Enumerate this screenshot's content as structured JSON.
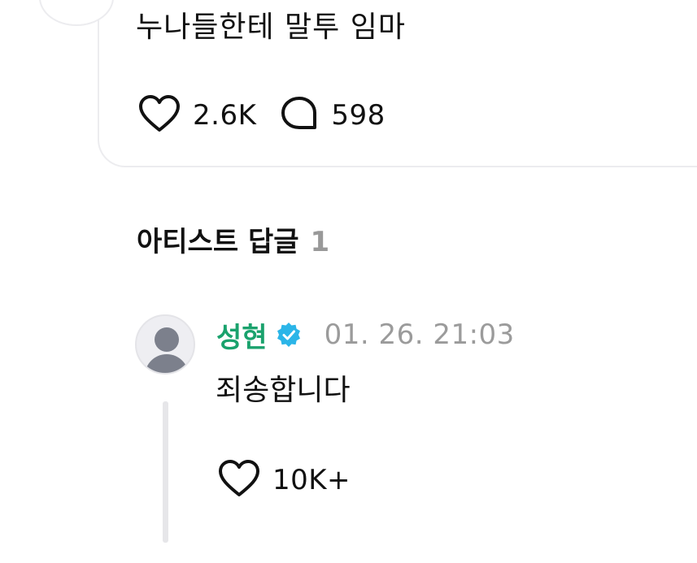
{
  "post": {
    "text": "누나들한테 말투 임마",
    "likes": "2.6K",
    "comments": "598"
  },
  "artist_replies": {
    "title": "아티스트 답글",
    "count": "1"
  },
  "reply": {
    "author": "성현",
    "timestamp": "01. 26. 21:03",
    "text": "죄송합니다",
    "likes": "10K+"
  },
  "colors": {
    "author_green": "#1aa26d",
    "verified_badge": "#2bb5e8",
    "muted_text": "#999999",
    "divider": "#ececef"
  },
  "icons": {
    "like": "heart-icon",
    "comment": "speech-bubble-icon",
    "verified": "verified-badge-icon",
    "avatar": "user-placeholder-icon"
  }
}
